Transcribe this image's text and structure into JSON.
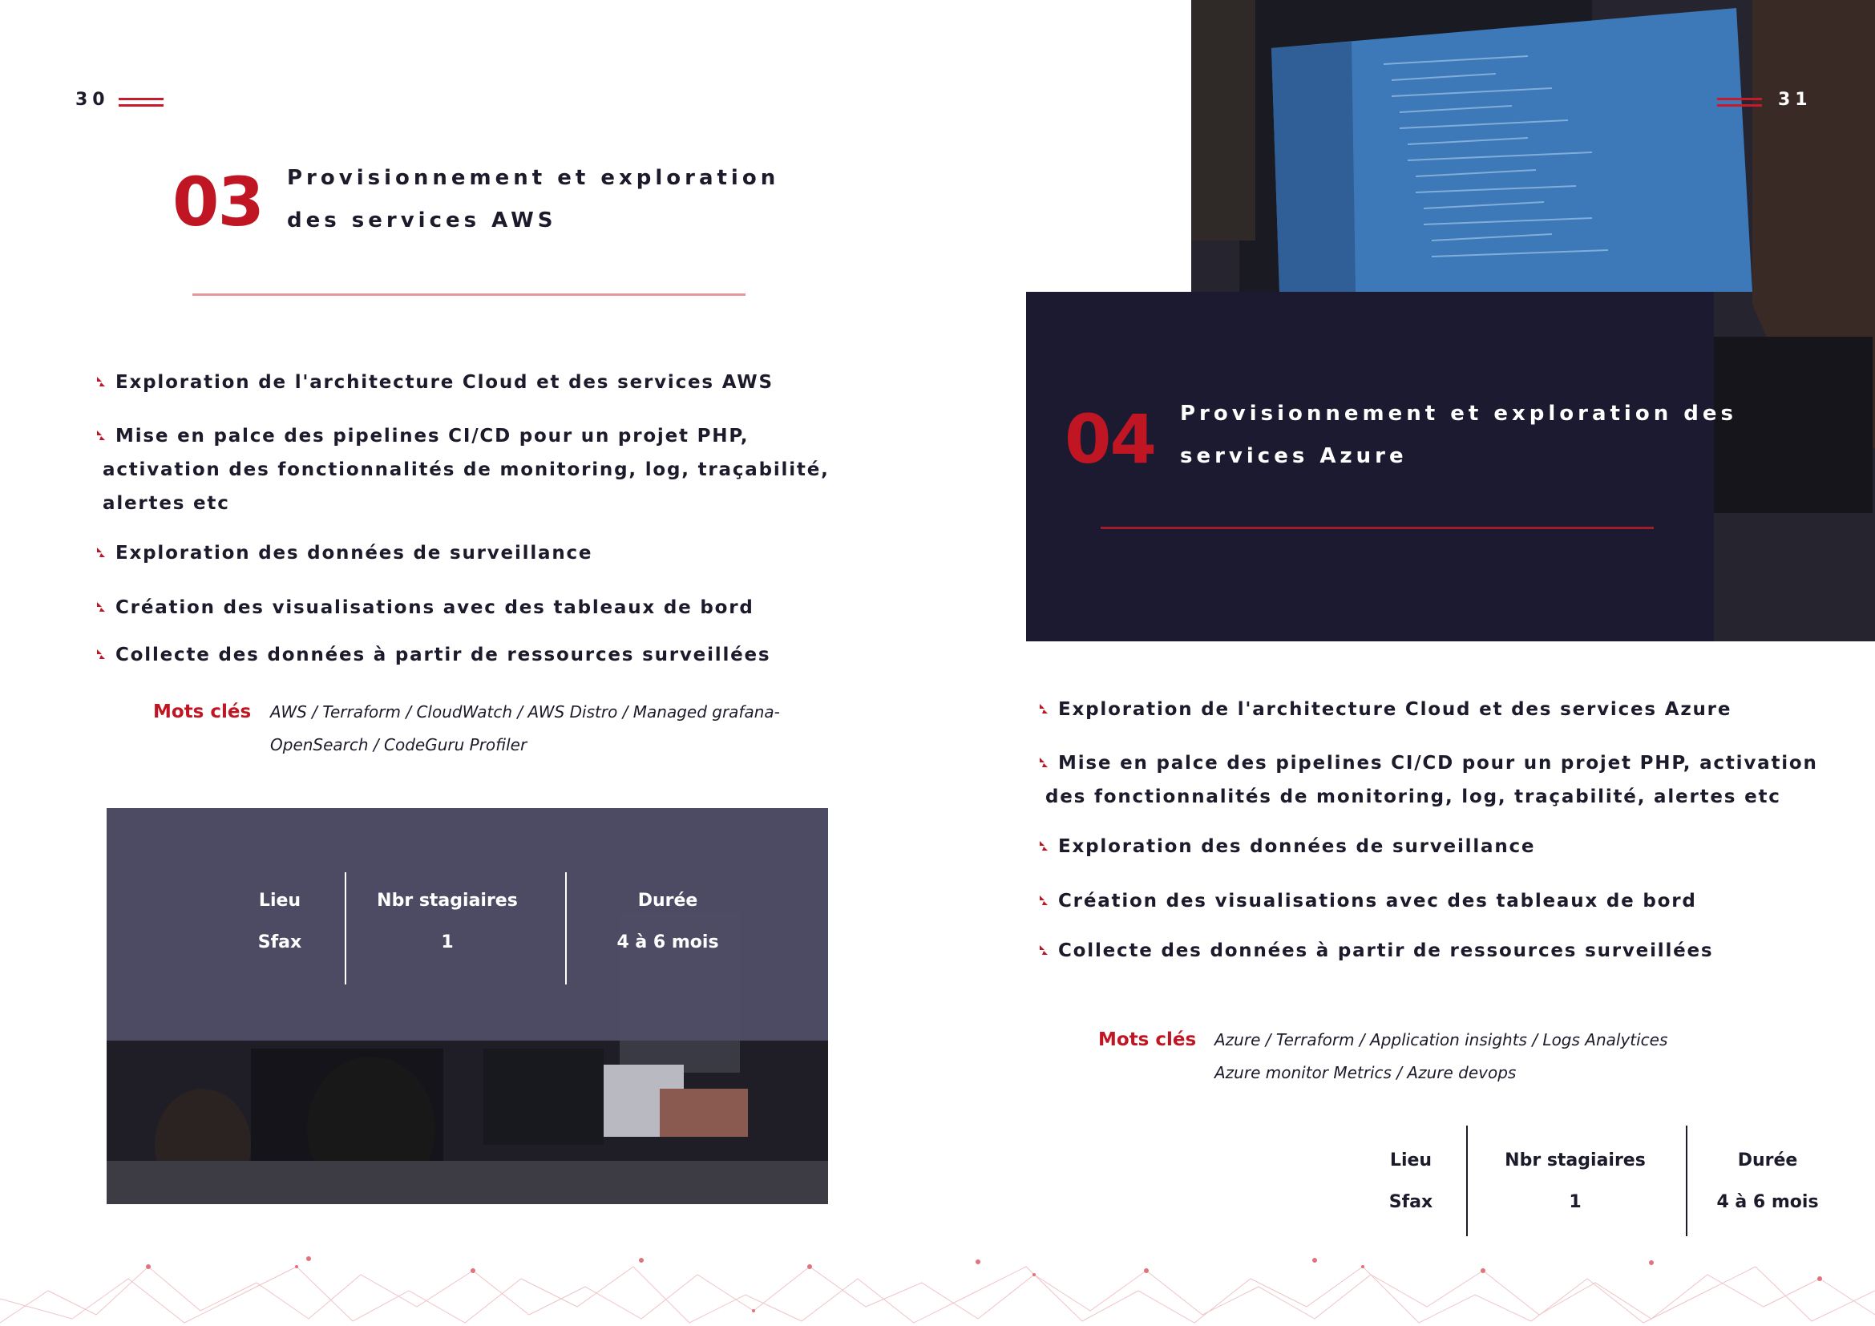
{
  "left_page": {
    "page_number": "30",
    "section_number": "03",
    "title_lines": [
      "Provisionnement et exploration",
      "des services AWS"
    ],
    "bullets": [
      {
        "line1": "Exploration de l'architecture Cloud et des services AWS"
      },
      {
        "line1": "Mise en palce des pipelines CI/CD pour un projet PHP,",
        "line2": "activation des fonctionnalités de monitoring, log, traçabilité,",
        "line3": "alertes etc"
      },
      {
        "line1": "Exploration des données de surveillance"
      },
      {
        "line1": "Création des visualisations avec des tableaux de bord"
      },
      {
        "line1": "Collecte des données à partir de ressources surveillées"
      }
    ],
    "keywords_label": "Mots clés",
    "keywords_lines": [
      "AWS / Terraform / CloudWatch / AWS Distro / Managed grafana-",
      "OpenSearch / CodeGuru Profiler"
    ],
    "info": {
      "lieu_label": "Lieu",
      "lieu_value": "Sfax",
      "stagiaires_label": "Nbr stagiaires",
      "stagiaires_value": "1",
      "duree_label": "Durée",
      "duree_value": "4 à 6 mois"
    }
  },
  "right_page": {
    "page_number": "31",
    "section_number": "04",
    "title_lines": [
      "Provisionnement et exploration des",
      "services Azure"
    ],
    "bullets": [
      {
        "line1": "Exploration de l'architecture Cloud et des services Azure"
      },
      {
        "line1": "Mise en palce des pipelines CI/CD pour un projet PHP, activation",
        "line2": "des fonctionnalités de monitoring, log, traçabilité, alertes etc"
      },
      {
        "line1": "Exploration des données de surveillance"
      },
      {
        "line1": "Création des visualisations avec des tableaux de bord"
      },
      {
        "line1": "Collecte des données à partir de ressources surveillées"
      }
    ],
    "keywords_label": "Mots clés",
    "keywords_lines": [
      "Azure / Terraform / Application insights / Logs Analytices",
      "Azure monitor Metrics / Azure devops"
    ],
    "info": {
      "lieu_label": "Lieu",
      "lieu_value": "Sfax",
      "stagiaires_label": "Nbr stagiaires",
      "stagiaires_value": "1",
      "duree_label": "Durée",
      "duree_value": "4 à 6 mois"
    }
  },
  "colors": {
    "accent_red": "#c01624",
    "navy_text": "#1c1b2b",
    "dark_panel": "#1c1a30",
    "divider_light": "#e8959b"
  }
}
